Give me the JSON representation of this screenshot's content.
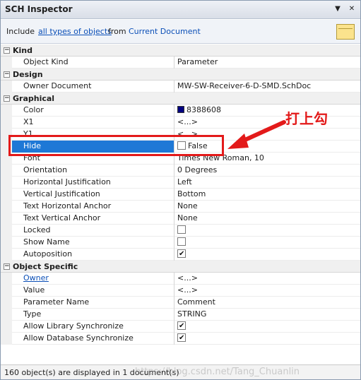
{
  "panel": {
    "title": "SCH Inspector",
    "pin_icon": "pin-icon",
    "close_icon": "close-icon",
    "filter": {
      "include_label": "Include",
      "types_link": "all types of objects",
      "from_label": "from",
      "scope_link": "Current Document",
      "folder_icon": "folder-icon"
    }
  },
  "sections": [
    {
      "name": "Kind",
      "toggle": "−",
      "rows": [
        {
          "name": "Object Kind",
          "value": "Parameter"
        }
      ]
    },
    {
      "name": "Design",
      "toggle": "−",
      "rows": [
        {
          "name": "Owner Document",
          "value": "MW-SW-Receiver-6-D-SMD.SchDoc"
        }
      ]
    },
    {
      "name": "Graphical",
      "toggle": "−",
      "rows": [
        {
          "name": "Color",
          "value": "8388608",
          "swatch": "#000080"
        },
        {
          "name": "X1",
          "value": "<...>"
        },
        {
          "name": "Y1",
          "value": "<...>"
        },
        {
          "name": "Hide",
          "value": "False",
          "checkbox": false
        },
        {
          "name": "Font",
          "value": "Times New Roman, 10"
        },
        {
          "name": "Orientation",
          "value": "0 Degrees"
        },
        {
          "name": "Horizontal Justification",
          "value": "Left"
        },
        {
          "name": "Vertical Justification",
          "value": "Bottom"
        },
        {
          "name": "Text Horizontal Anchor",
          "value": "None"
        },
        {
          "name": "Text Vertical Anchor",
          "value": "None"
        },
        {
          "name": "Locked",
          "checkbox": false
        },
        {
          "name": "Show Name",
          "checkbox": false
        },
        {
          "name": "Autoposition",
          "checkbox": true
        }
      ]
    },
    {
      "name": "Object Specific",
      "toggle": "−",
      "rows": [
        {
          "name": "Owner",
          "value": "<...>",
          "link": true
        },
        {
          "name": "Value",
          "value": "<...>"
        },
        {
          "name": "Parameter Name",
          "value": "Comment"
        },
        {
          "name": "Type",
          "value": "STRING"
        },
        {
          "name": "Allow Library Synchronize",
          "checkbox": true
        },
        {
          "name": "Allow Database Synchronize",
          "checkbox": true
        }
      ]
    }
  ],
  "status": {
    "text": "160 object(s) are displayed in 1 document(s)",
    "watermark": "https://blog.csdn.net/Tang_Chuanlin"
  },
  "annotation": {
    "text": "打上勾",
    "color": "#e31a1a"
  },
  "colors": {
    "selection": "#1e78d6",
    "link": "#0b4fb7"
  }
}
